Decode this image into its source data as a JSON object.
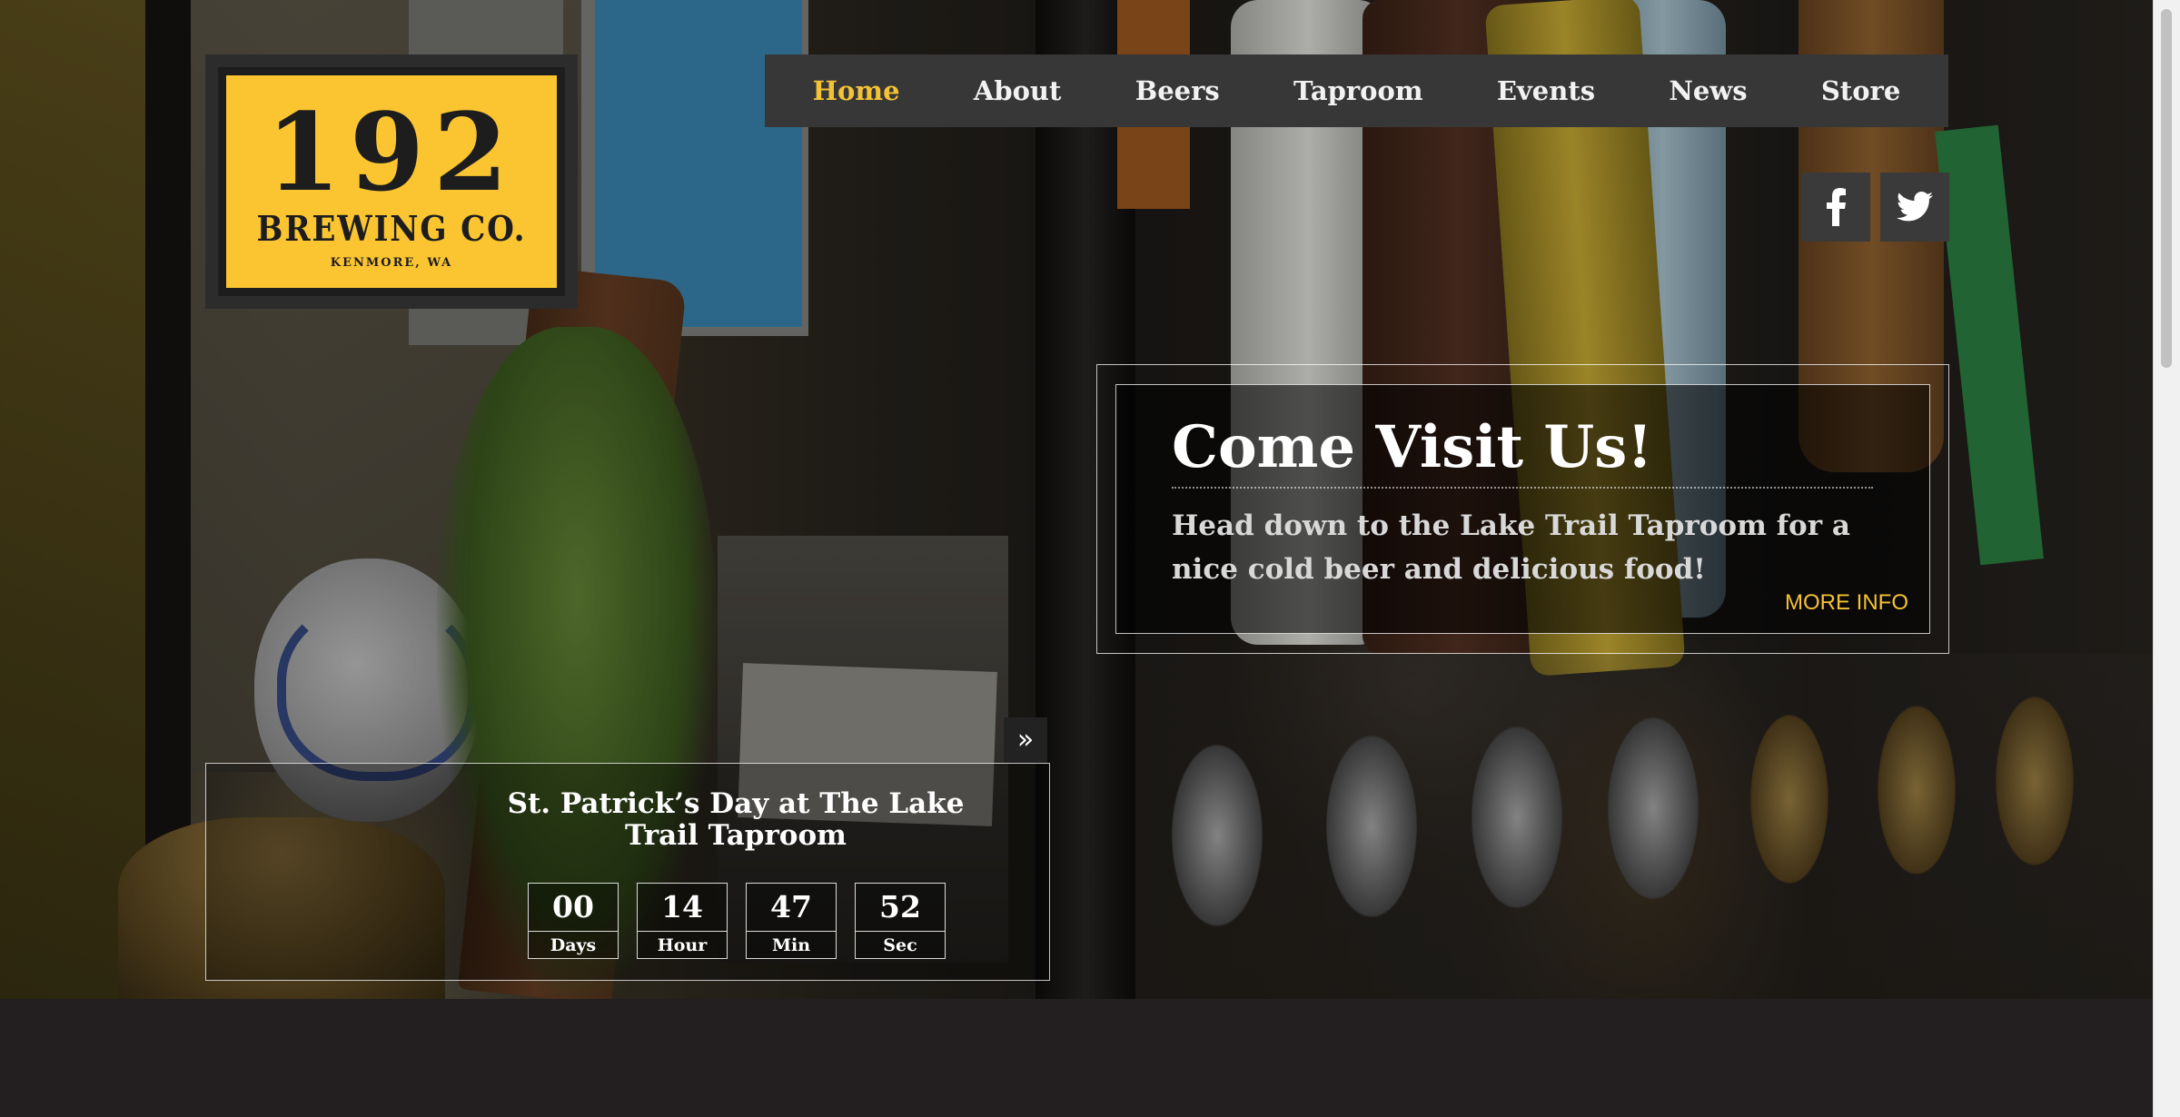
{
  "logo": {
    "number": "192",
    "name": "BREWING CO.",
    "location": "KENMORE, WA"
  },
  "nav": {
    "items": [
      {
        "label": "Home",
        "active": true
      },
      {
        "label": "About"
      },
      {
        "label": "Beers"
      },
      {
        "label": "Taproom"
      },
      {
        "label": "Events"
      },
      {
        "label": "News"
      },
      {
        "label": "Store"
      }
    ]
  },
  "social": {
    "facebook_icon": "f",
    "twitter_icon": "twitter-bird"
  },
  "visit": {
    "title": "Come Visit Us!",
    "text": "Head down to the Lake Trail Taproom for a nice cold beer and delicious food!",
    "more_label": "MORE INFO"
  },
  "event": {
    "arrow": "»",
    "title": "St. Patrick’s Day at The Lake Trail Taproom",
    "countdown": [
      {
        "value": "00",
        "label": "Days"
      },
      {
        "value": "14",
        "label": "Hour"
      },
      {
        "value": "47",
        "label": "Min"
      },
      {
        "value": "52",
        "label": "Sec"
      }
    ]
  },
  "colors": {
    "accent": "#f4c235",
    "nav_bg": "#373737",
    "logo_yellow": "#fbc531",
    "page_bg": "#231f20"
  }
}
